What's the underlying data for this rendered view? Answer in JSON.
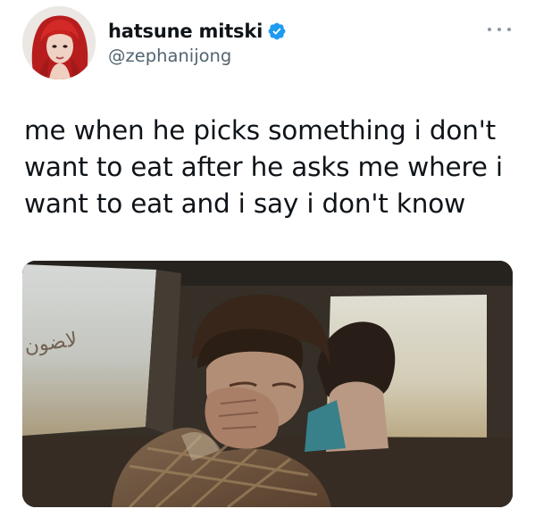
{
  "tweet": {
    "author": {
      "display_name": "hatsune mitski",
      "handle": "@zephanijong",
      "verified": true,
      "avatar_icon": "profile-avatar"
    },
    "more_icon": "more-horizontal-icon",
    "text_lines": [
      "me when he picks something i don't",
      "want to eat after he asks me where i",
      "want to eat and i say i don't know"
    ],
    "media": {
      "type": "still image",
      "window_writing": "ﻻﻀﻮﻥ"
    }
  },
  "colors": {
    "text": "#0f1419",
    "secondary_text": "#536471",
    "verified_badge": "#1d9bf0",
    "avatar_hair": "#c0201f"
  }
}
